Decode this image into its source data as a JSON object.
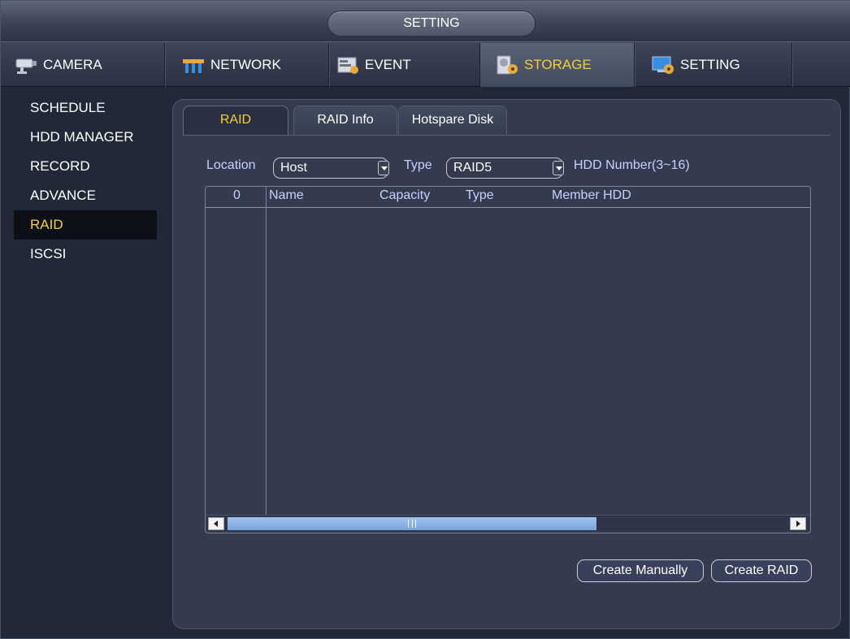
{
  "window": {
    "title": "SETTING"
  },
  "main_tabs": [
    {
      "label": "CAMERA",
      "icon": "camera-icon",
      "active": false
    },
    {
      "label": "NETWORK",
      "icon": "network-icon",
      "active": false
    },
    {
      "label": "EVENT",
      "icon": "event-icon",
      "active": false
    },
    {
      "label": "STORAGE",
      "icon": "storage-icon",
      "active": true
    },
    {
      "label": "SETTING",
      "icon": "setting-icon",
      "active": false
    }
  ],
  "sidebar": {
    "items": [
      {
        "label": "SCHEDULE",
        "active": false
      },
      {
        "label": "HDD MANAGER",
        "active": false
      },
      {
        "label": "RECORD",
        "active": false
      },
      {
        "label": "ADVANCE",
        "active": false
      },
      {
        "label": "RAID",
        "active": true
      },
      {
        "label": "ISCSI",
        "active": false
      }
    ]
  },
  "sub_tabs": [
    {
      "label": "RAID",
      "active": true
    },
    {
      "label": "RAID Info",
      "active": false
    },
    {
      "label": "Hotspare Disk",
      "active": false
    }
  ],
  "filters": {
    "location_label": "Location",
    "location_value": "Host",
    "type_label": "Type",
    "type_value": "RAID5",
    "hdd_number_label": "HDD Number(3~16)"
  },
  "table": {
    "columns": [
      "0",
      "Name",
      "Capacity",
      "Type",
      "Member HDD"
    ],
    "rows": []
  },
  "buttons": {
    "create_manually": "Create Manually",
    "create_raid": "Create RAID"
  },
  "colors": {
    "accent_active_text": "#f2cf3a",
    "label_text": "#c6d1ff",
    "panel_bg": "#343b4e",
    "window_bg": "#212838"
  }
}
